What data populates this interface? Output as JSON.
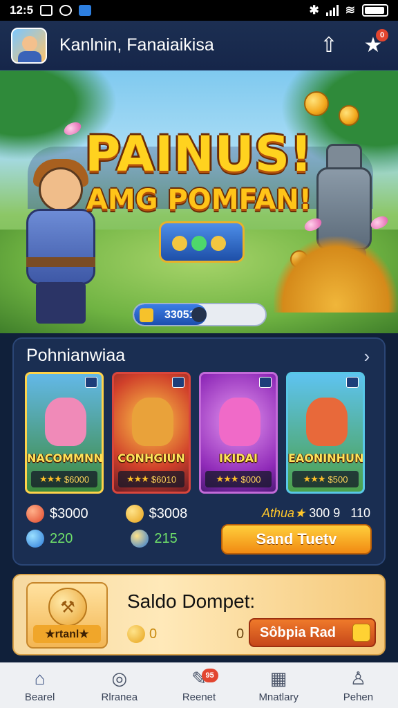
{
  "status_bar": {
    "time": "12:5",
    "icons": [
      "notification-icon",
      "sync-icon",
      "app-icon"
    ]
  },
  "header": {
    "app_title": "Kanlnin, Fanaiaikisa",
    "notif_count": "0"
  },
  "banner": {
    "title_line1": "PAINUS!",
    "title_line2": "AMG POMFAN!",
    "progress_value": "33051",
    "progress_fraction": 0.55
  },
  "promo": {
    "title": "Pohnianwiaa",
    "cards": [
      {
        "name": "NACOMMNN",
        "price": "$6000"
      },
      {
        "name": "CONHGIUN",
        "price": "$6010"
      },
      {
        "name": "IKIDAI",
        "price": "$000"
      },
      {
        "name": "EAONINHUN",
        "price": "$500"
      }
    ],
    "stats": {
      "coins_red": "$3000",
      "coins_gold": "$3008",
      "gems_blue": "220",
      "gems_gold": "215"
    },
    "right_label": "Athua★",
    "right_value1": "300 9",
    "right_value2": "110",
    "send_button": "Sand Tuetv"
  },
  "wallet": {
    "badge_label": "★rtanl★",
    "title": "Saldo Dompet:",
    "amount": "0",
    "zero": "0",
    "button": "Sôbpia Rad"
  },
  "nav": [
    {
      "label": "Bearel"
    },
    {
      "label": "Rlranea"
    },
    {
      "label": "Reenet",
      "badge": "95"
    },
    {
      "label": "Mnatlary"
    },
    {
      "label": "Pehen"
    }
  ],
  "colors": {
    "accent": "#f18a12",
    "panel": "#1a2e52",
    "header": "#1c2f52",
    "wallet": "#ffe9b9"
  }
}
